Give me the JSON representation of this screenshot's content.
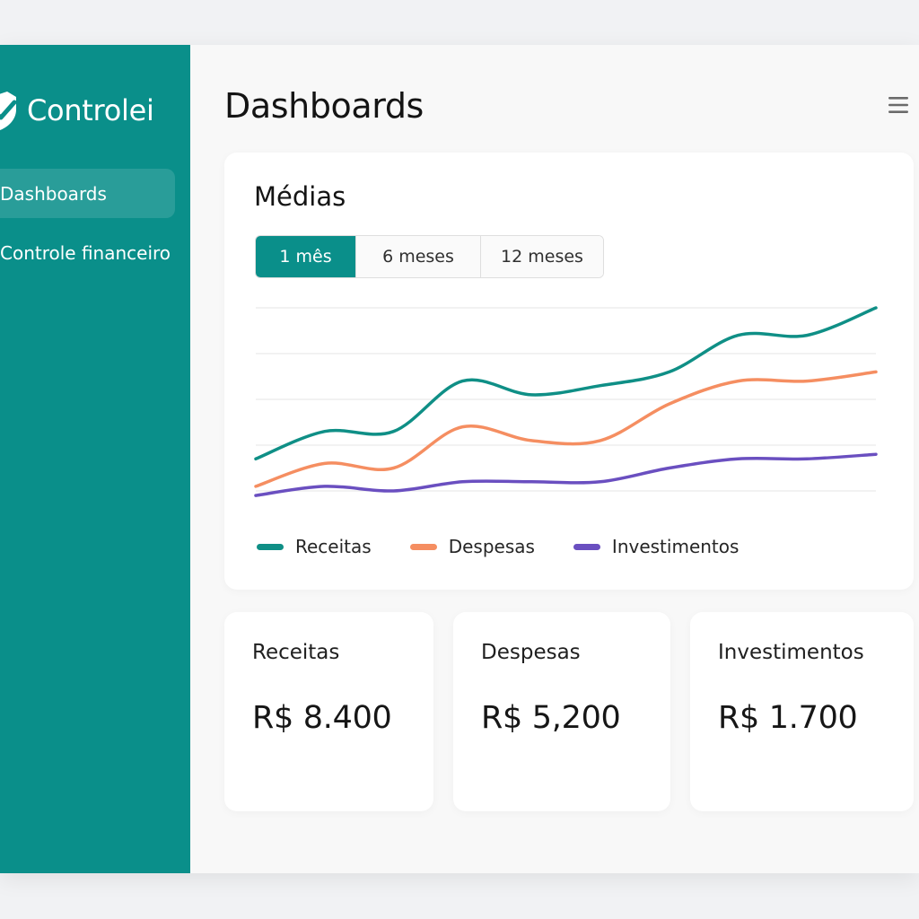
{
  "brand": {
    "name": "Controlei",
    "icon": "shield-check-icon"
  },
  "sidebar": {
    "items": [
      {
        "label": "Dashboards",
        "active": true
      },
      {
        "label": "Controle financeiro",
        "active": false
      }
    ]
  },
  "header": {
    "title": "Dashboards",
    "menu_icon": "hamburger-menu-icon"
  },
  "chart_card": {
    "title": "Médias",
    "tabs": [
      {
        "label": "1 mês",
        "active": true
      },
      {
        "label": "6 meses",
        "active": false
      },
      {
        "label": "12 meses",
        "active": false
      }
    ]
  },
  "chart_data": {
    "type": "line",
    "title": "Médias",
    "grid": true,
    "legend": "bottom-left",
    "x": [
      0,
      1,
      2,
      3,
      4,
      5,
      6,
      7,
      8,
      9
    ],
    "ylim": [
      0,
      4
    ],
    "series": [
      {
        "name": "Receitas",
        "color": "#0f8f86",
        "values": [
          0.7,
          1.3,
          1.3,
          2.4,
          2.1,
          2.3,
          2.6,
          3.4,
          3.4,
          4.0
        ]
      },
      {
        "name": "Despesas",
        "color": "#f58e61",
        "values": [
          0.1,
          0.6,
          0.5,
          1.4,
          1.1,
          1.1,
          1.9,
          2.4,
          2.4,
          2.6
        ]
      },
      {
        "name": "Investimentos",
        "color": "#6a4fc0",
        "values": [
          -0.1,
          0.1,
          0.0,
          0.2,
          0.2,
          0.2,
          0.5,
          0.7,
          0.7,
          0.8
        ]
      }
    ]
  },
  "stats": [
    {
      "label": "Receitas",
      "value": "R$ 8.400"
    },
    {
      "label": "Despesas",
      "value": "R$ 5,200"
    },
    {
      "label": "Investimentos",
      "value": "R$ 1.700"
    }
  ],
  "colors": {
    "accent": "#0a8f8a",
    "receitas": "#0f8f86",
    "despesas": "#f58e61",
    "investimentos": "#6a4fc0"
  }
}
